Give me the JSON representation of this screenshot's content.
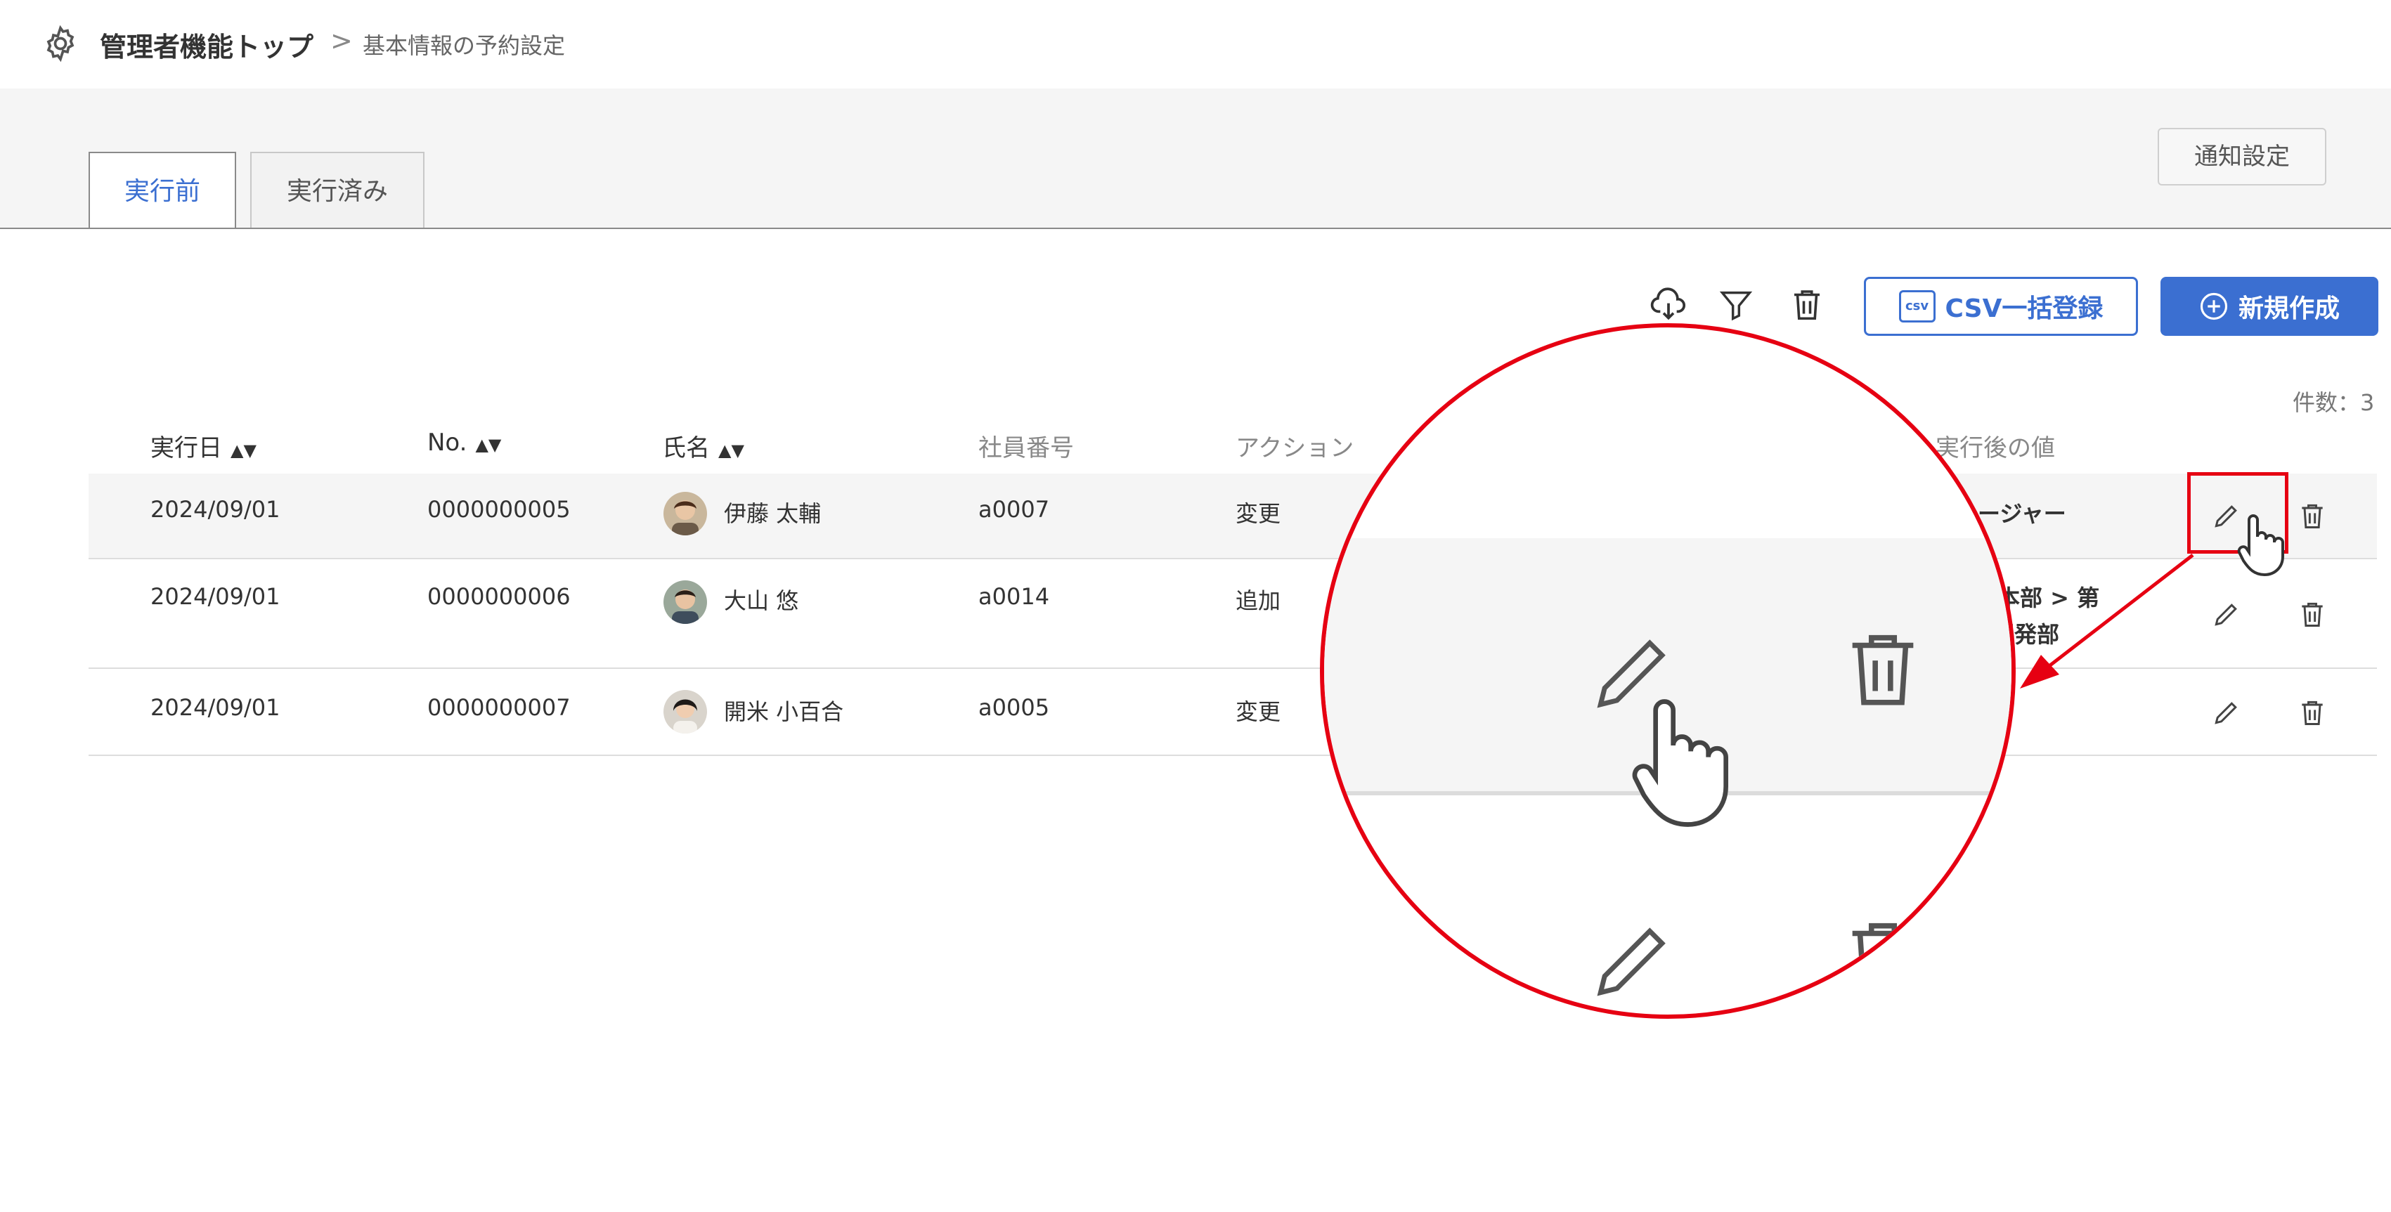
{
  "breadcrumb": {
    "root": "管理者機能トップ",
    "separator": ">",
    "current": "基本情報の予約設定"
  },
  "tabs": [
    {
      "label": "実行前",
      "active": true
    },
    {
      "label": "実行済み",
      "active": false
    }
  ],
  "buttons": {
    "notify": "通知設定",
    "csv": "CSV一括登録",
    "csv_icon_text": "csv",
    "new": "新規作成"
  },
  "count_label": "件数：3",
  "table": {
    "headers": [
      "実行日",
      "No.",
      "氏名",
      "社員番号",
      "アクション",
      "実行後の値"
    ],
    "rows": [
      {
        "date": "2024/09/01",
        "no": "0000000005",
        "name": "伊藤 太輔",
        "emp": "a0007",
        "action": "変更",
        "after": "ネージャー",
        "after2": ""
      },
      {
        "date": "2024/09/01",
        "no": "0000000006",
        "name": "大山 悠",
        "emp": "a0014",
        "action": "追加",
        "after": "発本部 > 第",
        "after2": "開発部"
      },
      {
        "date": "2024/09/01",
        "no": "0000000007",
        "name": "開米 小百合",
        "emp": "a0005",
        "action": "変更",
        "after": "",
        "after2": ""
      }
    ]
  },
  "colors": {
    "accent": "#3b6fd1",
    "highlight": "#e60012"
  }
}
